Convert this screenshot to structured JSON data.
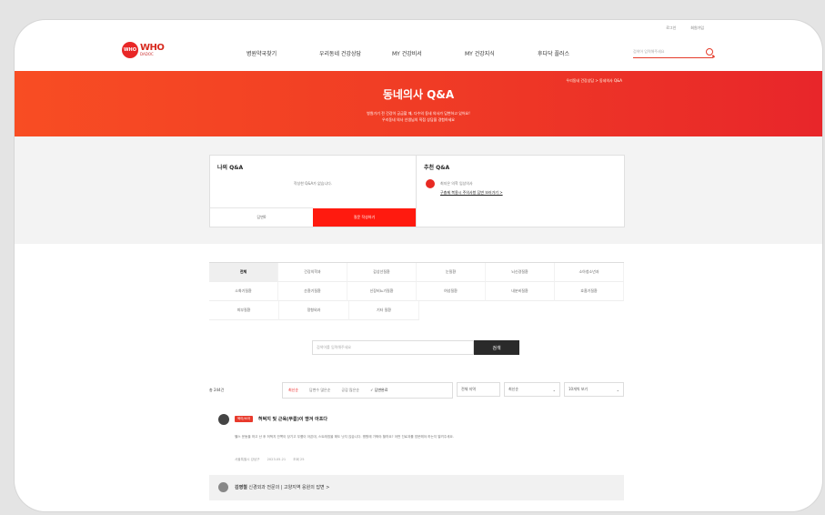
{
  "topbar": {
    "login": "로그인",
    "join": "회원가입"
  },
  "logo": {
    "mark": "WHO",
    "line1": "WHO",
    "line2": "DADOC"
  },
  "nav": [
    "병원약국찾기",
    "우리동네 건강상담",
    "MY 건강비서",
    "MY 건강지식",
    "후다닥 플러스"
  ],
  "header_search": {
    "placeholder": "검색어 입력해주세요",
    "icon": "search-icon"
  },
  "hero": {
    "title": "동네의사 Q&A",
    "line1": "병원가기 전 건강이 궁금할 때, 다수의 동네 의사가 답변하고 있어요!",
    "line2": "우리동네 의사 선생님의 직접 상담을 경험하세요",
    "breadcrumb": "우리동네 건강상담 > 동네의사 Q&A"
  },
  "my_qa": {
    "title": "나의 Q&A",
    "empty": "작성한 Q&A가 없습니다.",
    "btn_mine": "답변0",
    "btn_write": "질문 작성하기"
  },
  "recommend": {
    "title": "추천 Q&A",
    "doctor": "최지은 의학 임상의사",
    "link": "구충제 복용시 주의사항 답변 보러가기 >"
  },
  "categories": [
    [
      "전체",
      "건강의학과",
      "갑상선질환",
      "눈질환",
      "뇌신경질환",
      "소아청소년과"
    ],
    [
      "소화기질환",
      "순환기질환",
      "신장비뇨기질환",
      "여성질환",
      "내분비질환",
      "호흡기질환"
    ],
    [
      "피부질환",
      "정형외과",
      "기타 질환"
    ]
  ],
  "search_mid": {
    "placeholder": "검색어를 입력해주세요",
    "button": "검색"
  },
  "filter": {
    "total": "총 244건",
    "seg": [
      "최신순",
      "답변수 많은순",
      "공감 많은순"
    ],
    "seg_check": "✓ 답변완료",
    "location": "전체 지역",
    "sort": "최신순",
    "perpage": "10개씩 보기"
  },
  "post": {
    "tag": "육아/소아",
    "title": "허벅지 및 근육(무릎)이 땅겨 아프다",
    "body": "헬스 운동을 하고 난 후 허벅지 안쪽이 당기고 무릎이 아픈데, 스트레칭을 해도 낫지 않습니다. 병원에 가봐야 할까요? 어떤 진료과를 방문해야 하는지 알려주세요.",
    "author": "서울특별시 강남구",
    "date": "2023.05.21",
    "views": "조회 25"
  },
  "answer": {
    "doctor": "김영철",
    "text": "신경외과 전문의 | 고양지역 응원의 답변 >"
  }
}
